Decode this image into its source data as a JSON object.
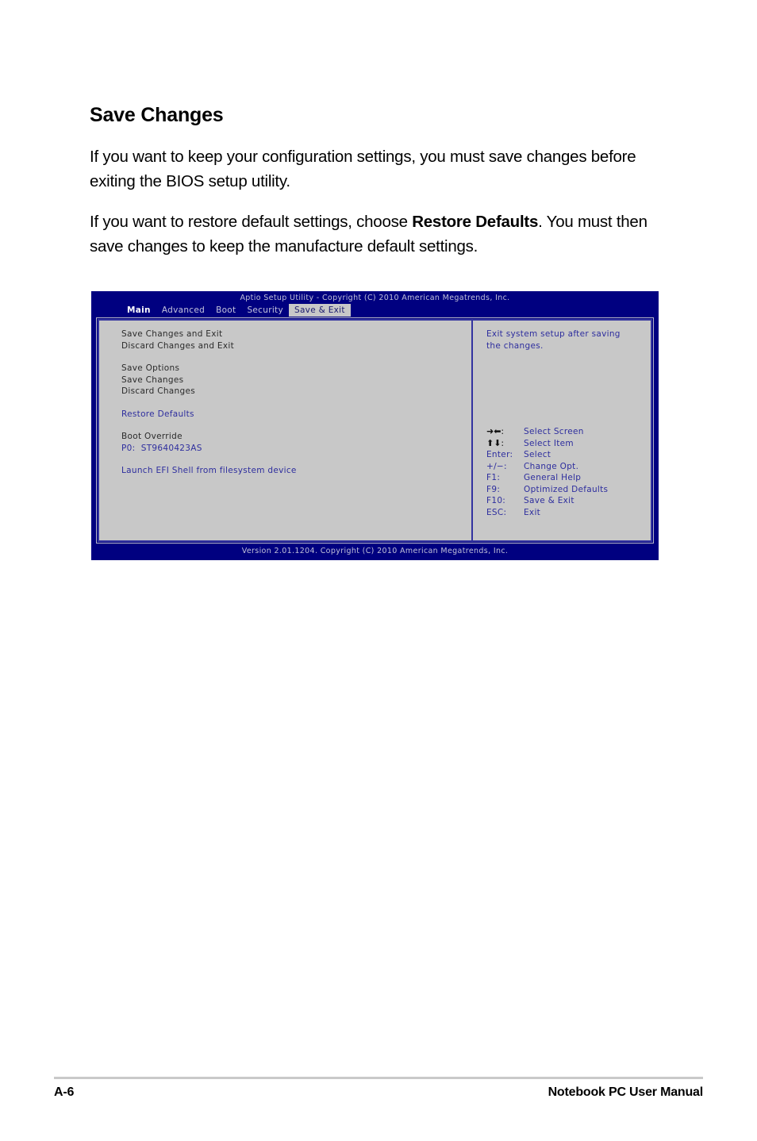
{
  "document": {
    "heading": "Save Changes",
    "paragraph1": "If you want to keep your configuration settings, you must save changes before exiting the BIOS setup utility.",
    "paragraph2_part1": "If you want to restore default settings, choose ",
    "paragraph2_bold": "Restore Defaults",
    "paragraph2_part2": ". You must then save changes to keep the manufacture default settings."
  },
  "bios": {
    "title": "Aptio Setup Utility - Copyright (C) 2010 American Megatrends, Inc.",
    "tabs": [
      {
        "label": "Main",
        "selected": false
      },
      {
        "label": "Advanced",
        "selected": false
      },
      {
        "label": "Boot",
        "selected": false
      },
      {
        "label": "Security",
        "selected": false
      },
      {
        "label": "Save & Exit",
        "selected": true
      }
    ],
    "menu": [
      {
        "label": "Save Changes and Exit",
        "style": "dark"
      },
      {
        "label": "Discard Changes and Exit",
        "style": "dark"
      },
      {
        "label": "",
        "style": "spacer"
      },
      {
        "label": "Save Options",
        "style": "dark"
      },
      {
        "label": "Save Changes",
        "style": "dark"
      },
      {
        "label": "Discard Changes",
        "style": "dark"
      },
      {
        "label": "",
        "style": "spacer"
      },
      {
        "label": "Restore Defaults",
        "style": "blue"
      },
      {
        "label": "",
        "style": "spacer"
      },
      {
        "label": "Boot Override",
        "style": "dark"
      },
      {
        "label": "P0:  ST9640423AS",
        "style": "blue"
      },
      {
        "label": "",
        "style": "spacer"
      },
      {
        "label": "Launch EFI Shell from filesystem device",
        "style": "blue"
      }
    ],
    "help_line1": "Exit system setup after saving",
    "help_line2": "the changes.",
    "keys": [
      {
        "key": "➜⬅:",
        "desc": "Select Screen",
        "glyph": true
      },
      {
        "key": "⬆⬇:",
        "desc": "Select Item",
        "glyph": true
      },
      {
        "key": "Enter:",
        "desc": "Select",
        "glyph": false
      },
      {
        "key": "+/−:",
        "desc": "Change Opt.",
        "glyph": false
      },
      {
        "key": "F1:",
        "desc": "General Help",
        "glyph": false
      },
      {
        "key": "F9:",
        "desc": "Optimized Defaults",
        "glyph": false
      },
      {
        "key": "F10:",
        "desc": "Save & Exit",
        "glyph": false
      },
      {
        "key": "ESC:",
        "desc": "Exit",
        "glyph": false
      }
    ],
    "footer": "Version 2.01.1204. Copyright (C) 2010 American Megatrends, Inc."
  },
  "page_footer": {
    "page_number": "A-6",
    "manual_title": "Notebook PC User Manual"
  },
  "colors": {
    "bios_background": "#000080",
    "bios_panel": "#c8c8c8",
    "bios_accent_text": "#2e2e9e",
    "bios_title_text": "#c0c0d8"
  }
}
